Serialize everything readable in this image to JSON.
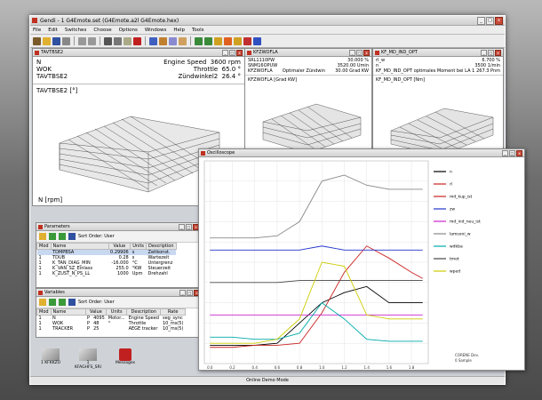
{
  "app": {
    "title": "Gendi - 1 G4Emote.set (G4Emote.a2l G4Emote.hex)",
    "statusbar": "Online Demo Mode"
  },
  "menu": [
    "File",
    "Edit",
    "Switches",
    "Choose",
    "Options",
    "Windows",
    "Help",
    "Tools"
  ],
  "tavt": {
    "title": "TAVTBSE2",
    "rows": [
      {
        "n": "N",
        "p": "Engine Speed",
        "v": "3600",
        "u": "rpm"
      },
      {
        "n": "WOK",
        "p": "Throttle",
        "v": "65.0",
        "u": "°"
      },
      {
        "n": "TAVTBSE2",
        "p": "Zündwinkel2",
        "v": "26.4",
        "u": "°"
      }
    ],
    "plot_label": "TAVTBSE2 [°]",
    "axis_label": "N [rpm]"
  },
  "kfz": {
    "title": "KFZWOFLA",
    "rows": [
      {
        "a": "SRL1110PW",
        "b": "30.000",
        "c": "%"
      },
      {
        "a": "SNM16OPUW",
        "b": "3520.00",
        "c": "Umin"
      },
      {
        "a": "KFZWOFLA",
        "d": "Optimaler Zündwin",
        "b": "30.00",
        "c": "Grad KW"
      }
    ],
    "plot_label": "KFZWOFLA [Grad KW]"
  },
  "kfmd": {
    "title": "KF_MD_IND_OPT",
    "rows": [
      {
        "a": "rl_w",
        "b": "6.700",
        "c": "%"
      },
      {
        "a": "n",
        "b": "3500",
        "c": "1/min"
      },
      {
        "a": "KF_MD_IND_OPT",
        "d": "optimales Moment bei LA 1",
        "b": "267.3",
        "c": "Pnm"
      }
    ],
    "plot_label": "KF_MD_IND_OPT [Nm]"
  },
  "params": {
    "title": "Parameters",
    "sort": "Sort Order: User",
    "headers": [
      "Mod",
      "Name",
      "Value",
      "Units",
      "Description"
    ],
    "rows": [
      [
        "",
        "TDMPBSA",
        "0.29906",
        "s",
        "Zeitkonst."
      ],
      [
        "1",
        "TDUB",
        "0.28",
        "s",
        "Wartezeit"
      ],
      [
        "1",
        "K_TAN_DIAG_MIN",
        "-16.000",
        "°C",
        "Untergrenz"
      ],
      [
        "1",
        "K_VAN_SZ_Einlass",
        "255.0",
        "°KW",
        "Steuerzeit"
      ],
      [
        "1",
        "K_ZUST_N_PS_LL",
        "1000",
        "Upm",
        "Drehzahl"
      ]
    ]
  },
  "vars": {
    "title": "Variables",
    "sort": "Sort Order: User",
    "headers": [
      "Mod",
      "Name",
      "Value",
      "Units",
      "Description",
      "Rate"
    ],
    "rows": [
      [
        "1",
        "N",
        "P",
        "4095",
        "Motor...",
        "Engine Speed",
        "seg_sync"
      ],
      [
        "1",
        "WOK",
        "P",
        "48",
        "°",
        "Throttle",
        "10_ms(5)"
      ],
      [
        "1",
        "TRACKER",
        "P",
        "25",
        "",
        "AEGE tracker",
        "10_ms(5)"
      ]
    ]
  },
  "desktop": {
    "icons": [
      "1 KFKKZU",
      "1 KFAGHFS_SRI",
      "Messages"
    ]
  },
  "osc": {
    "title": "Oscilloscope",
    "legend": [
      {
        "label": "n",
        "color": "#000000"
      },
      {
        "label": "rl",
        "color": "#cc2222"
      },
      {
        "label": "md_kup_ist",
        "color": "#cc2222"
      },
      {
        "label": "zw",
        "color": "#2233cc"
      },
      {
        "label": "md_ind_neu_ist",
        "color": "#cc22cc"
      },
      {
        "label": "lamsoni_w",
        "color": "#888888"
      },
      {
        "label": "wdkba",
        "color": "#00aaaa"
      },
      {
        "label": "tmot",
        "color": "#444444"
      },
      {
        "label": "wped",
        "color": "#cccc00"
      }
    ],
    "xticks": [
      "0.0",
      "0.2",
      "0.4",
      "0.6",
      "0.8",
      "1.0",
      "1.2",
      "1.4",
      "1.6",
      "1.8"
    ],
    "footer": [
      "CORENE Dev.",
      "0 Sample"
    ]
  },
  "chart_data": {
    "type": "line",
    "title": "Oscilloscope",
    "x": [
      0.0,
      0.2,
      0.4,
      0.6,
      0.8,
      1.0,
      1.2,
      1.4,
      1.6,
      1.8,
      1.9
    ],
    "xlim": [
      -0.05,
      1.95
    ],
    "ylim": [
      0,
      100
    ],
    "series": [
      {
        "name": "n",
        "color": "#000000",
        "values": [
          9,
          9,
          9,
          10,
          20,
          30,
          35,
          38,
          30,
          30,
          30
        ]
      },
      {
        "name": "rl",
        "color": "#cc2222",
        "values": [
          8,
          8,
          9,
          9,
          10,
          25,
          45,
          58,
          52,
          45,
          42
        ]
      },
      {
        "name": "zw",
        "color": "#2233cc",
        "values": [
          56,
          56,
          56,
          56,
          56,
          58,
          56,
          56,
          56,
          56,
          56
        ]
      },
      {
        "name": "md_ind_neu_ist",
        "color": "#cc22cc",
        "values": [
          24,
          24,
          24,
          24,
          24,
          24,
          24,
          24,
          24,
          24,
          24
        ]
      },
      {
        "name": "lamsoni_w",
        "color": "#888888",
        "values": [
          62,
          62,
          62,
          63,
          70,
          90,
          93,
          88,
          86,
          86,
          86
        ]
      },
      {
        "name": "wdkba",
        "color": "#00aaaa",
        "values": [
          13,
          13,
          12,
          12,
          15,
          30,
          22,
          12,
          11,
          11,
          11
        ]
      },
      {
        "name": "tmot",
        "color": "#444444",
        "values": [
          40,
          40,
          40,
          40,
          41,
          41,
          41,
          41,
          41,
          41,
          41
        ]
      },
      {
        "name": "wped",
        "color": "#cccc00",
        "values": [
          10,
          10,
          10,
          12,
          22,
          50,
          48,
          24,
          22,
          22,
          22
        ]
      }
    ]
  }
}
